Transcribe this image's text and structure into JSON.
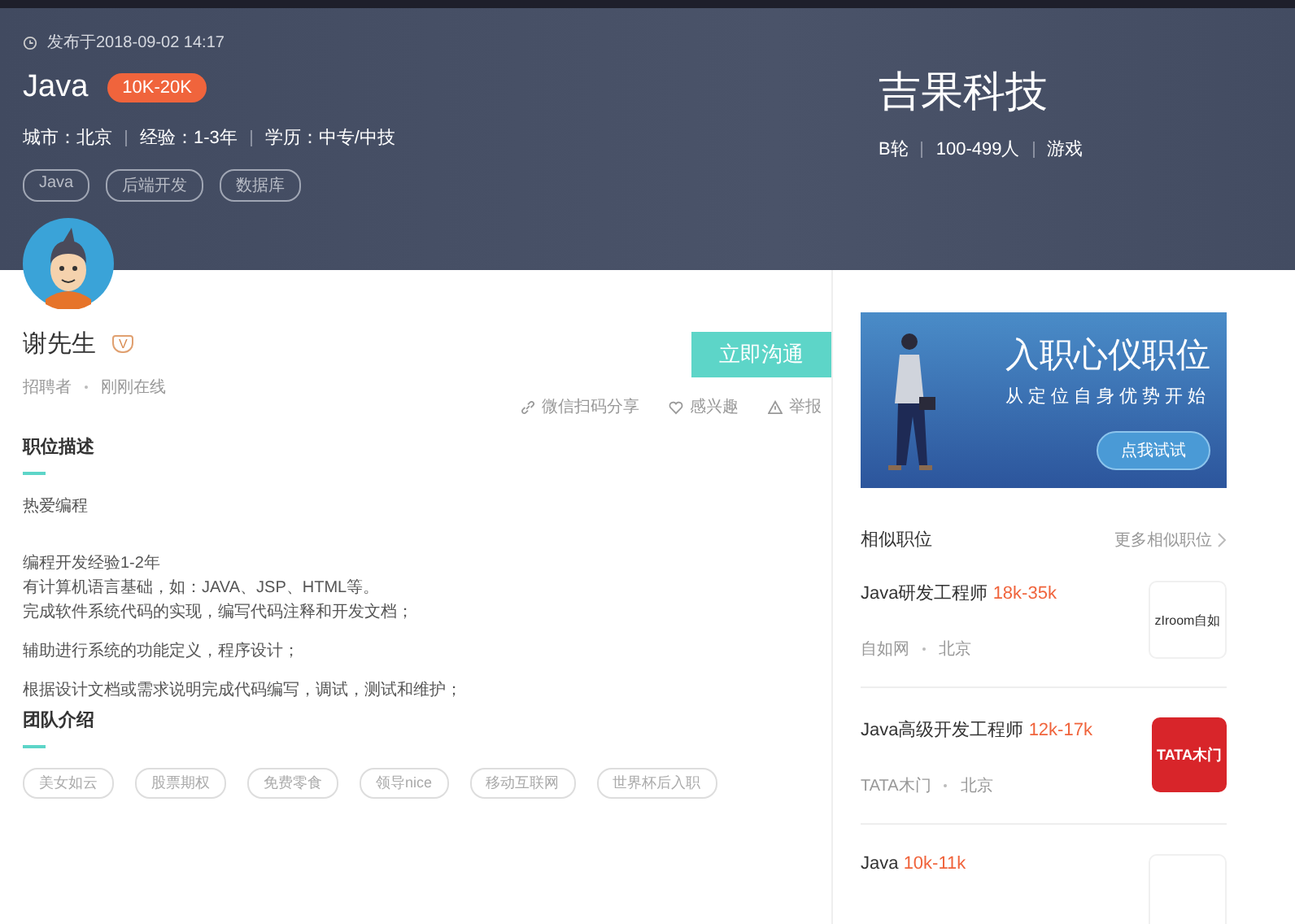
{
  "header": {
    "published": "发布于2018-09-02 14:17",
    "job_title": "Java",
    "salary": "10K-20K",
    "requirements": [
      "城市：北京",
      "经验：1-3年",
      "学历：中专/中技"
    ],
    "tags": [
      "Java",
      "后端开发",
      "数据库"
    ],
    "company": {
      "name": "吉果科技",
      "facts": [
        "B轮",
        "100-499人",
        "游戏"
      ]
    }
  },
  "recruiter": {
    "name": "谢先生",
    "badge": "V",
    "role": "招聘者",
    "status": "刚刚在线"
  },
  "chat_button": "立即沟通",
  "actions": [
    {
      "kind": "share",
      "label": "微信扫码分享"
    },
    {
      "kind": "like",
      "label": "感兴趣"
    },
    {
      "kind": "report",
      "label": "举报"
    }
  ],
  "description": {
    "title": "职位描述",
    "paragraphs": [
      [
        "热爱编程"
      ],
      [
        "编程开发经验1-2年",
        "有计算机语言基础，如：JAVA、JSP、HTML等。",
        "完成软件系统代码的实现，编写代码注释和开发文档；"
      ],
      [
        "辅助进行系统的功能定义，程序设计；"
      ],
      [
        "根据设计文档或需求说明完成代码编写，调试，测试和维护；"
      ]
    ]
  },
  "team": {
    "title": "团队介绍",
    "tags": [
      "美女如云",
      "股票期权",
      "免费零食",
      "领导nice",
      "移动互联网",
      "世界杯后入职"
    ]
  },
  "banner": {
    "title": "入职心仪职位",
    "subtitle": "从定位自身优势开始",
    "button": "点我试试"
  },
  "similar": {
    "title": "相似职位",
    "more": "更多相似职位",
    "jobs": [
      {
        "title": "Java研发工程师",
        "salary": "18k-35k",
        "company": "自如网",
        "city": "北京",
        "logo": "zIroom自如",
        "kind": "light"
      },
      {
        "title": "Java高级开发工程师",
        "salary": "12k-17k",
        "company": "TATA木门",
        "city": "北京",
        "logo": "TATA木门",
        "kind": "red"
      },
      {
        "title": "Java",
        "salary": "10k-11k",
        "kind": "light"
      }
    ]
  }
}
